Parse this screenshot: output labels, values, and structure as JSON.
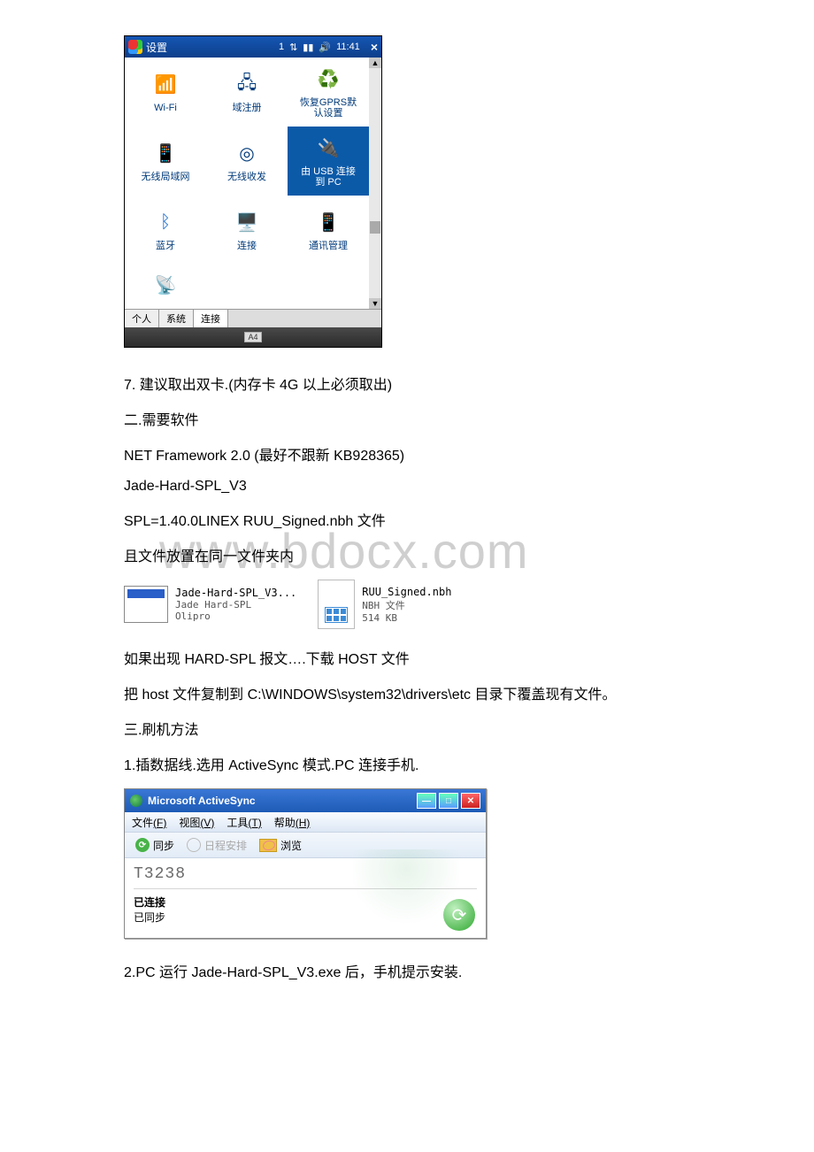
{
  "wm": {
    "titlebar": {
      "title": "设置",
      "indicator": "1",
      "time": "11:41"
    },
    "items": [
      {
        "label": "Wi-Fi"
      },
      {
        "label": "域注册"
      },
      {
        "label": "恢复GPRS默\n认设置"
      },
      {
        "label": "无线局域网"
      },
      {
        "label": "无线收发"
      },
      {
        "label": "由 USB 连接\n到 PC",
        "selected": true
      },
      {
        "label": "蓝牙"
      },
      {
        "label": "连接"
      },
      {
        "label": "通讯管理"
      }
    ],
    "tabs": {
      "t1": "个人",
      "t2": "系统",
      "t3": "连接"
    },
    "bottom_key": "A4"
  },
  "text": {
    "step7": "7. 建议取出双卡.(内存卡 4G 以上必须取出)",
    "sec2": "二.需要软件",
    "net": "NET Framework 2.0 (最好不跟新 KB928365)",
    "jade": "Jade-Hard-SPL_V3",
    "spl": "SPL=1.40.0LINEX RUU_Signed.nbh 文件",
    "same_folder": "且文件放置在同一文件夹内",
    "hardspl_err": "如果出现 HARD-SPL 报文….下载 HOST 文件",
    "copy_host": "把 host 文件复制到 C:\\WINDOWS\\system32\\drivers\\etc 目录下覆盖现有文件。",
    "sec3": "三.刷机方法",
    "step1": "1.插数据线.选用 ActiveSync 模式.PC 连接手机.",
    "step2": "2.PC 运行 Jade-Hard-SPL_V3.exe 后，手机提示安装."
  },
  "files": {
    "exe": {
      "name": "Jade-Hard-SPL_V3...",
      "line2": "Jade Hard-SPL",
      "line3": "Olipro"
    },
    "nbh": {
      "name": "RUU_Signed.nbh",
      "line2": "NBH 文件",
      "line3": "514 KB"
    }
  },
  "activesync": {
    "title": "Microsoft ActiveSync",
    "menu": {
      "file": "文件",
      "file_key": "(F)",
      "view": "视图",
      "view_key": "(V)",
      "tools": "工具",
      "tools_key": "(T)",
      "help": "帮助",
      "help_key": "(H)"
    },
    "toolbar": {
      "sync": "同步",
      "schedule": "日程安排",
      "browse": "浏览"
    },
    "device": "T3238",
    "status_connected": "已连接",
    "status_synced": "已同步"
  },
  "watermark": "www.bdocx.com"
}
